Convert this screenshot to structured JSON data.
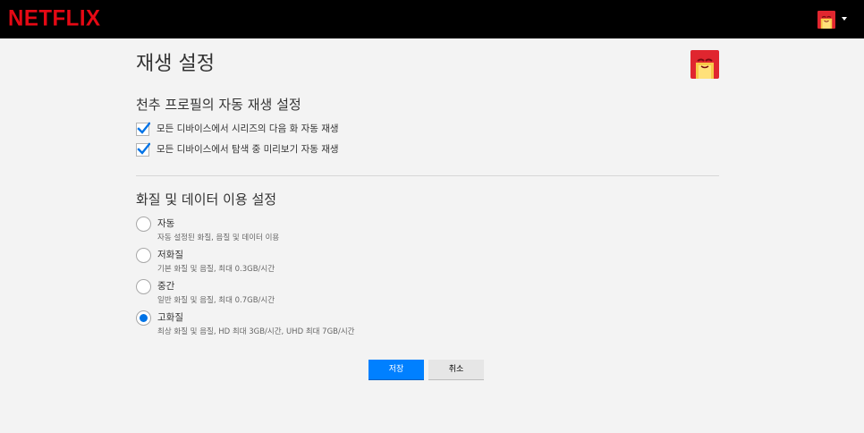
{
  "header": {
    "logo_text": "NETFLIX",
    "brand_color": "#e50914",
    "avatar_icon": "profile-avatar-icon",
    "menu_icon": "caret-down-icon"
  },
  "page": {
    "title": "재생 설정"
  },
  "autoplay": {
    "title": "천추 프로필의 자동 재생 설정",
    "options": [
      {
        "label": "모든 디바이스에서 시리즈의 다음 화 자동 재생",
        "checked": true
      },
      {
        "label": "모든 디바이스에서 탐색 중 미리보기 자동 재생",
        "checked": true
      }
    ]
  },
  "quality": {
    "title": "화질 및 데이터 이용 설정",
    "options": [
      {
        "label": "자동",
        "description": "자동 설정된 화질, 음질 및 데이터 이용",
        "selected": false
      },
      {
        "label": "저화질",
        "description": "기본 화질 및 음질, 최대 0.3GB/시간",
        "selected": false
      },
      {
        "label": "중간",
        "description": "일반 화질 및 음질, 최대 0.7GB/시간",
        "selected": false
      },
      {
        "label": "고화질",
        "description": "최상 화질 및 음질, HD 최대 3GB/시간, UHD 최대 7GB/시간",
        "selected": true
      }
    ],
    "accent_color": "#0073e6"
  },
  "actions": {
    "save_label": "저장",
    "cancel_label": "취소",
    "save_color": "#0080ff"
  }
}
